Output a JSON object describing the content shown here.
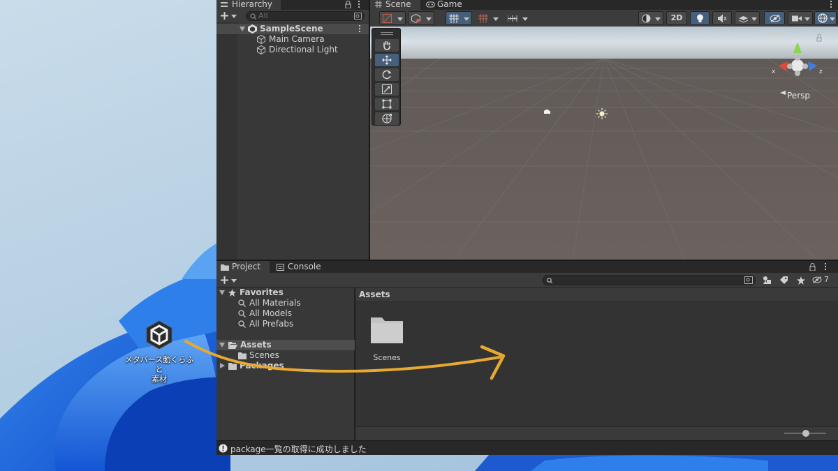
{
  "desktop": {
    "icon_name": "unity-icon",
    "icon_label_line1": "メタバース動くらふと",
    "icon_label_line2": "素材",
    "annotation": "curved-arrow"
  },
  "hierarchy": {
    "tab_label": "Hierarchy",
    "search_placeholder": "All",
    "scene_name": "SampleScene",
    "objects": [
      "Main Camera",
      "Directional Light"
    ]
  },
  "scene_view": {
    "tabs": [
      "Scene",
      "Game"
    ],
    "toolbar_2d_label": "2D",
    "projection_label": "Persp",
    "gizmo_axes": [
      "y",
      "x",
      "z"
    ],
    "tools": [
      "hand-tool",
      "move-tool",
      "rotate-tool",
      "scale-tool",
      "rect-tool",
      "transform-tool"
    ],
    "active_tool_index": 1
  },
  "project": {
    "tabs": [
      "Project",
      "Console"
    ],
    "favorites_label": "Favorites",
    "favorites": [
      "All Materials",
      "All Models",
      "All Prefabs"
    ],
    "assets_label": "Assets",
    "assets_children": [
      "Scenes"
    ],
    "packages_label": "Packages",
    "breadcrumb": "Assets",
    "grid_items": [
      "Scenes"
    ],
    "hidden_count": "7"
  },
  "status_bar": {
    "message": "package一覧の取得に成功しました"
  },
  "colors": {
    "selection": "#46607c",
    "arrow": "#e8a930",
    "desktop_blue": "#1f6fe0"
  }
}
